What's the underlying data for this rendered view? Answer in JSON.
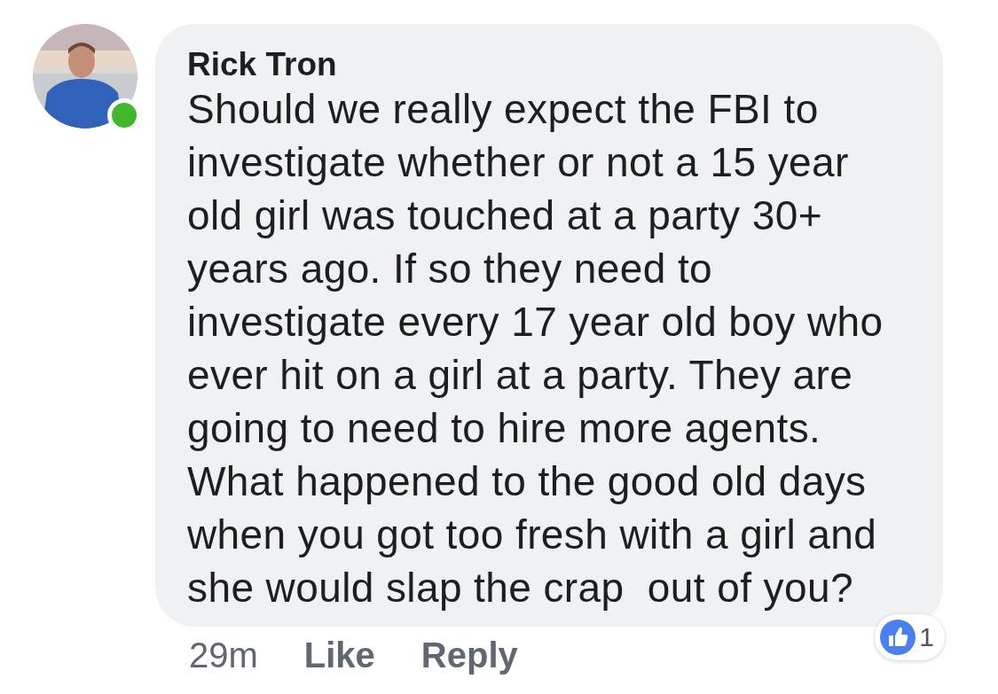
{
  "comment": {
    "author": "Rick Tron",
    "online": true,
    "text": "Should we really expect the FBI to\ninvestigate whether or not a 15 year\nold girl was touched at a party 30+\nyears ago. If so they need to\ninvestigate every 17 year old boy who\never hit on a girl at a party. They are\ngoing to need to hire more agents.\nWhat happened to the good old days\nwhen you got too fresh with a girl and\nshe would slap the crap  out of you?",
    "time": "29m",
    "actions": [
      "Like",
      "Reply"
    ],
    "reactions": {
      "count": "1"
    }
  }
}
